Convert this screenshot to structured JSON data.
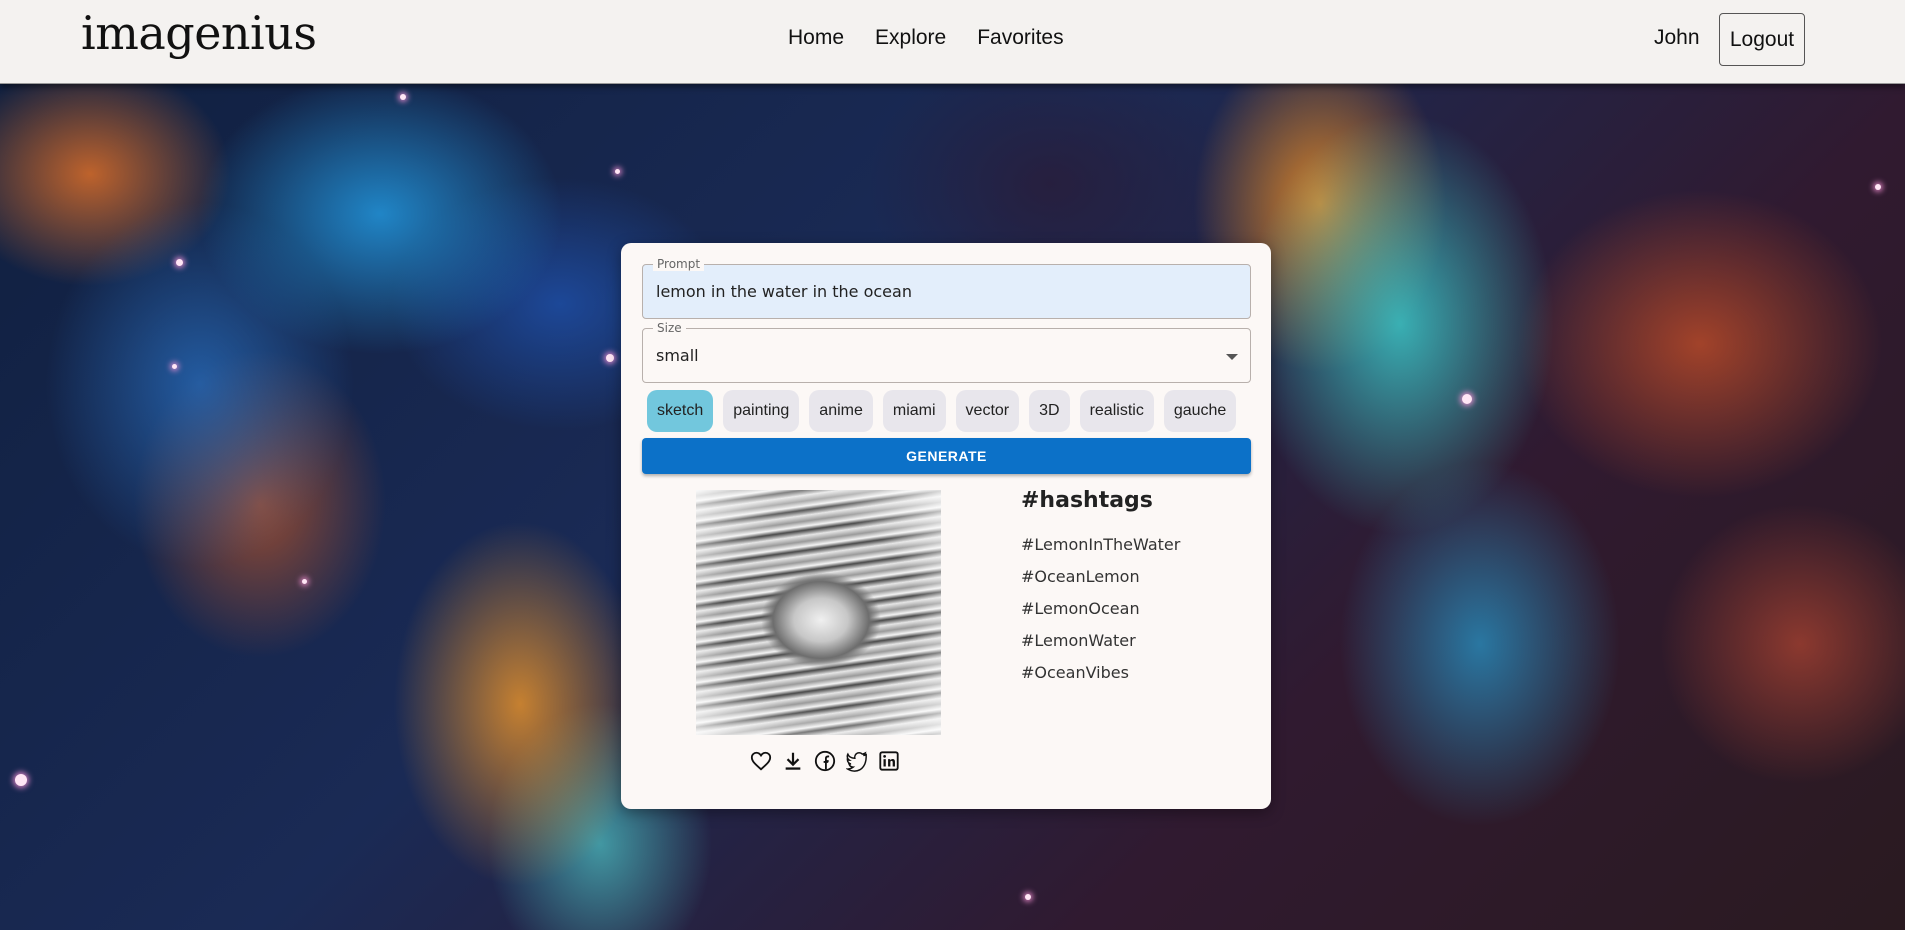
{
  "header": {
    "logo": "imagenius",
    "nav": [
      "Home",
      "Explore",
      "Favorites"
    ],
    "user_name": "John",
    "logout_label": "Logout"
  },
  "form": {
    "prompt_label": "Prompt",
    "prompt_value": "lemon in the water in the ocean",
    "size_label": "Size",
    "size_value": "small",
    "styles": [
      "sketch",
      "painting",
      "anime",
      "miami",
      "vector",
      "3D",
      "realistic",
      "gauche"
    ],
    "active_style": "sketch",
    "generate_label": "GENERATE"
  },
  "result": {
    "actions": [
      "heart-icon",
      "download-icon",
      "facebook-icon",
      "twitter-icon",
      "linkedin-icon"
    ]
  },
  "hashtags": {
    "title": "#hashtags",
    "items": [
      "#LemonInTheWater",
      "#OceanLemon",
      "#LemonOcean",
      "#LemonWater",
      "#OceanVibes"
    ]
  },
  "colors": {
    "header_bg": "#f4f2f0",
    "card_bg": "#fcf8f6",
    "primary": "#0c71c8",
    "chip_active": "#72c7dd",
    "chip_bg": "#e8e6ec"
  }
}
